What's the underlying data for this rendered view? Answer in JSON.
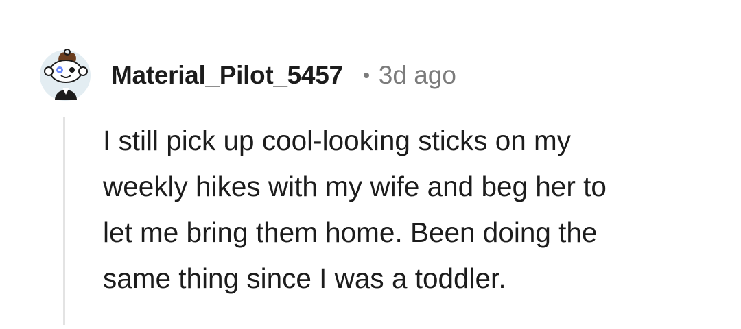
{
  "comment": {
    "author": {
      "username": "Material_Pilot_5457",
      "avatar_icon": "reddit-snoo-avatar-icon"
    },
    "separator": "•",
    "timestamp": "3d ago",
    "body_lines": [
      "I still pick up cool-looking sticks on my",
      "weekly hikes with my wife and beg her to",
      "let me bring them home. Been doing the",
      "same thing since I was a toddler."
    ]
  },
  "colors": {
    "background": "#ffffff",
    "text_primary": "#1c1c1c",
    "text_meta": "#7c7c7c",
    "thread_line": "#e3e3e3",
    "avatar_background": "#e3edf2"
  }
}
